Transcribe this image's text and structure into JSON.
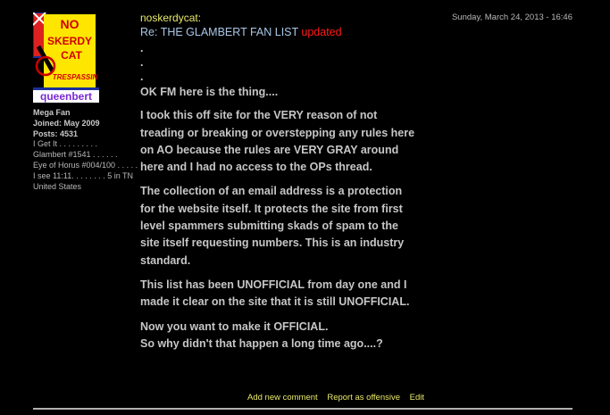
{
  "user": {
    "name": "noskerdycat:",
    "avatar_text": {
      "line1": "NO",
      "line2": "SKERDY",
      "line3": "CAT",
      "line4": "TRESPASSIN",
      "line5": "queenbert"
    },
    "rank": "Mega Fan",
    "joined": "Joined: May 2009",
    "posts": "Posts: 4531",
    "lines": [
      "I Get It . . . . . . . . .",
      "Glambert #1541 . . . . . .",
      "Eye of Horus #004/100 . . . . . I see 11:11. . . . . . . . 5 in TN",
      "United States"
    ]
  },
  "post": {
    "date": "Sunday, March 24, 2013 - 16:46",
    "title": "Re: THE GLAMBERT FAN LIST",
    "title_updated": "updated",
    "dots": [
      ".",
      ".",
      "."
    ],
    "paragraphs": [
      "OK FM here is the thing....",
      "I took this off site for the VERY reason of not treading or breaking or overstepping any rules here on AO because the rules are VERY GRAY around here and I had no access to the OPs thread.",
      "The collection of an email address is a protection for the website itself. It protects the site from first level spammers submitting skads of spam to the site itself requesting numbers. This is an industry standard.",
      "This list has been UNOFFICIAL from day one and I made it clear on the site that it is still UNOFFICIAL.",
      "Now you want to make it OFFICIAL.\nSo why didn't that happen a long time ago....?"
    ]
  },
  "actions": {
    "add_comment": "Add new comment",
    "report": "Report as offensive",
    "edit": "Edit"
  },
  "colors": {
    "background": "#000000",
    "username": "#e8e86a",
    "title": "#a9c7e6",
    "updated": "#ff1a1a",
    "body_text": "#c6c6c6",
    "links": "#e8e86a"
  }
}
